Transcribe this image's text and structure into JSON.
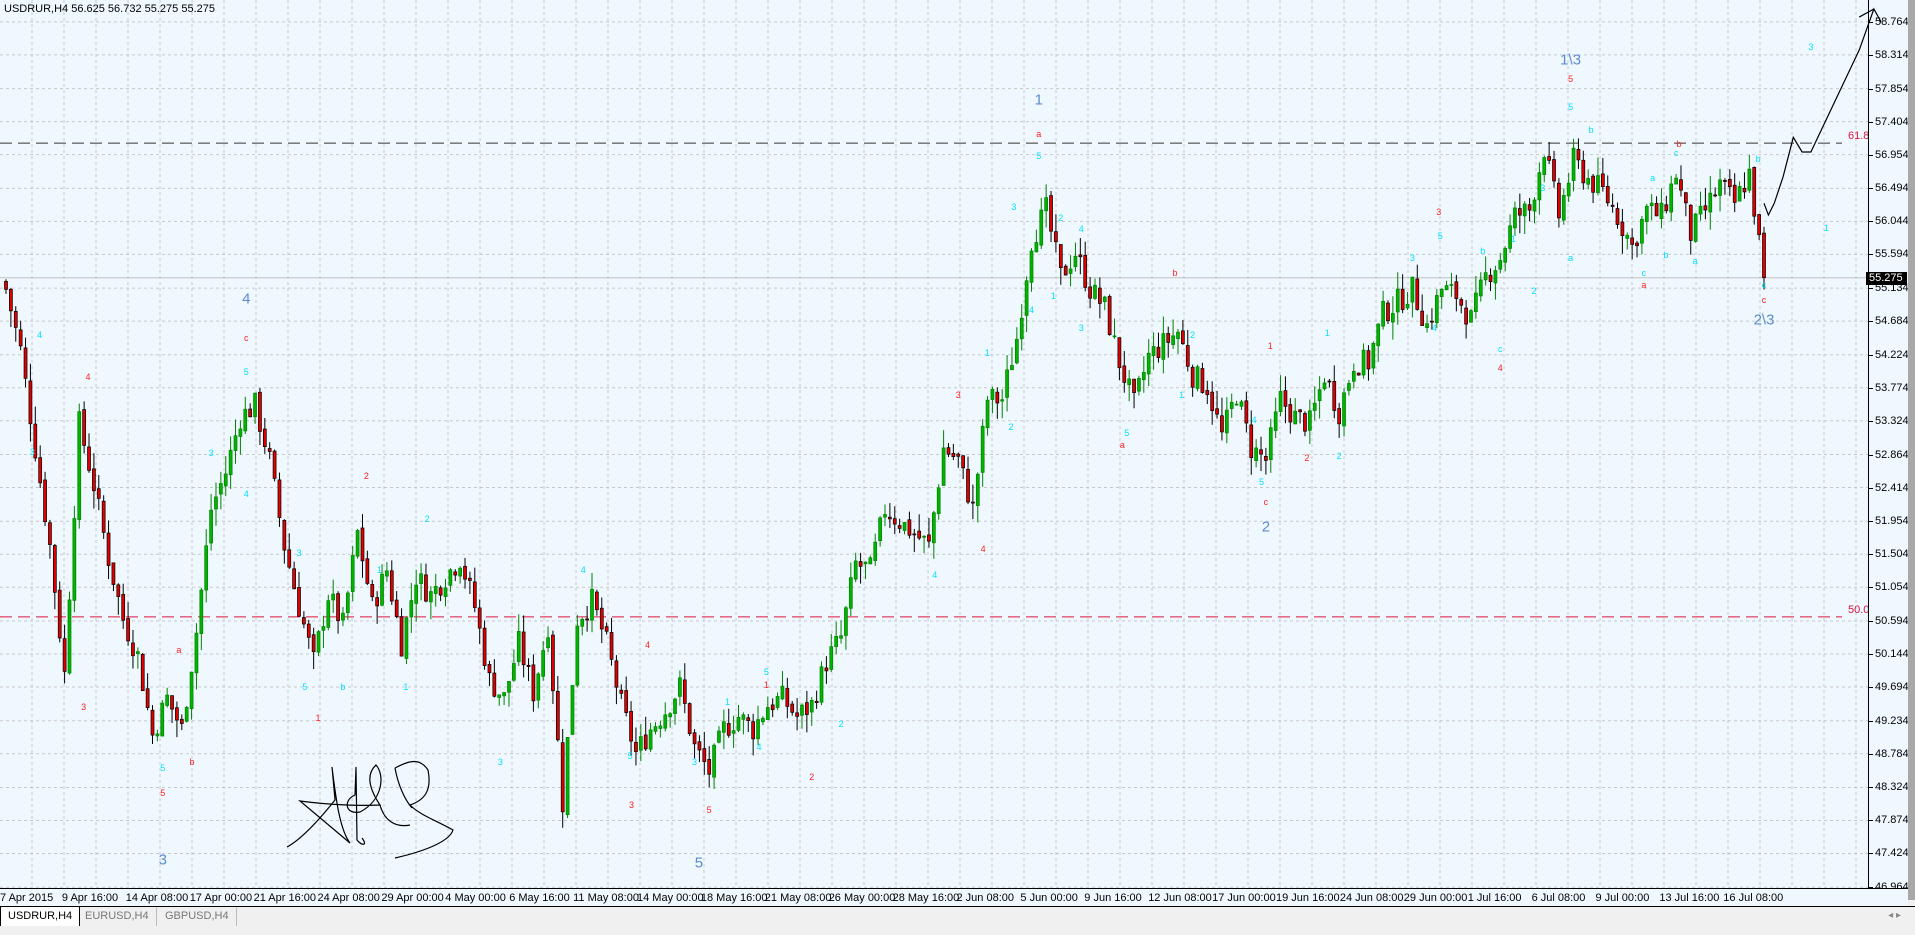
{
  "header": {
    "title": "USDRUR,H4  56.625 56.732 55.275 55.275"
  },
  "tabs": [
    {
      "label": "USDRUR,H4",
      "active": true
    },
    {
      "label": "EURUSD,H4",
      "active": false
    },
    {
      "label": "GBPUSD,H4",
      "active": false
    }
  ],
  "tab_scroll_label": "◂ ▸",
  "colors": {
    "background": "#f0f8ff",
    "bull": "#00b400",
    "bear": "#e00000",
    "level_line": "#dc143c",
    "wave_big": "#5b8bd0",
    "wave_red": "#ff2020",
    "wave_cyan": "#00e0ff"
  },
  "chart_data": {
    "type": "candlestick",
    "symbol": "USDRUR",
    "timeframe": "H4",
    "ohlc_header": {
      "open": 56.625,
      "high": 56.732,
      "low": 55.275,
      "close": 55.275
    },
    "current_price": 55.275,
    "current_price_label": "55.275",
    "ylim": [
      46.964,
      59.06
    ],
    "y_ticks": [
      "58.764",
      "58.314",
      "57.854",
      "57.404",
      "56.954",
      "56.494",
      "56.044",
      "55.594",
      "55.134",
      "54.684",
      "54.224",
      "53.774",
      "53.324",
      "52.864",
      "52.414",
      "51.954",
      "51.504",
      "51.054",
      "50.594",
      "50.144",
      "49.694",
      "49.234",
      "48.784",
      "48.324",
      "47.874",
      "47.424",
      "46.964"
    ],
    "x_ticks": [
      "7 Apr 2015",
      "9 Apr 16:00",
      "14 Apr 08:00",
      "17 Apr 00:00",
      "21 Apr 16:00",
      "24 Apr 08:00",
      "29 Apr 00:00",
      "4 May 00:00",
      "6 May 16:00",
      "11 May 08:00",
      "14 May 00:00",
      "18 May 16:00",
      "21 May 08:00",
      "26 May 00:00",
      "28 May 16:00",
      "2 Jun 08:00",
      "5 Jun 00:00",
      "9 Jun 16:00",
      "12 Jun 08:00",
      "17 Jun 00:00",
      "19 Jun 16:00",
      "24 Jun 08:00",
      "29 Jun 00:00",
      "1 Jul 16:00",
      "6 Jul 08:00",
      "9 Jul 00:00",
      "13 Jul 16:00",
      "16 Jul 08:00"
    ],
    "bars_per_point": 3,
    "closes": [
      55.12,
      54.29,
      52.95,
      51.62,
      49.87,
      53.29,
      52.45,
      51.45,
      50.62,
      50.12,
      49.04,
      49.54,
      49.12,
      50.45,
      52.12,
      52.62,
      53.37,
      53.54,
      52.79,
      51.62,
      50.79,
      50.04,
      50.95,
      50.54,
      51.79,
      50.79,
      51.29,
      50.29,
      51.2,
      50.95,
      51.2,
      51.45,
      50.79,
      49.79,
      49.54,
      50.29,
      49.62,
      50.54,
      48.12,
      50.62,
      50.87,
      50.29,
      49.45,
      48.79,
      49.12,
      49.37,
      49.7,
      48.87,
      48.54,
      49.12,
      49.29,
      49.12,
      49.45,
      49.54,
      49.29,
      49.45,
      50.04,
      50.37,
      51.37,
      51.29,
      52.12,
      51.95,
      51.79,
      51.62,
      52.95,
      52.79,
      52.12,
      53.62,
      53.62,
      54.45,
      55.79,
      56.2,
      55.29,
      55.62,
      55.12,
      54.87,
      54.12,
      53.54,
      54.2,
      54.37,
      54.54,
      53.95,
      53.79,
      53.12,
      53.7,
      52.95,
      52.79,
      53.62,
      53.37,
      53.29,
      53.95,
      53.45,
      54.12,
      54.12,
      54.79,
      54.95,
      55.12,
      54.62,
      55.12,
      55.04,
      54.7,
      55.29,
      55.54,
      56.12,
      56.2,
      57.04,
      56.12,
      56.87,
      56.62,
      56.45,
      56.12,
      55.7,
      56.2,
      56.12,
      56.7,
      55.87,
      56.2,
      56.54,
      56.29,
      56.7,
      55.275
    ],
    "levels": [
      {
        "label": "61.8",
        "price": 57.11,
        "style": "dashed-dark"
      },
      {
        "label": "50.0",
        "price": 50.65,
        "style": "dashed-red"
      }
    ],
    "forecast_path": [
      [
        120,
        56.29
      ],
      [
        120.3,
        56.13
      ],
      [
        120.7,
        56.29
      ],
      [
        121.3,
        56.65
      ],
      [
        122,
        57.19
      ],
      [
        122.6,
        56.99
      ],
      [
        123.2,
        56.99
      ],
      [
        126.5,
        58.38
      ],
      [
        127.5,
        58.94
      ],
      [
        128,
        58.76
      ]
    ],
    "forecast_branch": [
      [
        126.5,
        58.83
      ],
      [
        127.5,
        58.94
      ]
    ],
    "wave_labels": [
      {
        "t": "4",
        "k": 16.4,
        "p": 54.99,
        "c": "big"
      },
      {
        "t": "1",
        "k": 70.5,
        "p": 57.7,
        "c": "big"
      },
      {
        "t": "1\\3",
        "k": 106.8,
        "p": 58.25,
        "c": "big"
      },
      {
        "t": "2\\3",
        "k": 120,
        "p": 54.7,
        "c": "big"
      },
      {
        "t": "2",
        "k": 86,
        "p": 51.87,
        "c": "big"
      },
      {
        "t": "3",
        "k": 10.7,
        "p": 47.34,
        "c": "big"
      },
      {
        "t": "5",
        "k": 47.3,
        "p": 47.29,
        "c": "big"
      },
      {
        "t": "4",
        "k": 5.6,
        "p": 53.92,
        "c": "red"
      },
      {
        "t": "3",
        "k": 5.3,
        "p": 49.42,
        "c": "red"
      },
      {
        "t": "5",
        "k": 10.7,
        "p": 48.25,
        "c": "red"
      },
      {
        "t": "b",
        "k": 12.7,
        "p": 48.67,
        "c": "red"
      },
      {
        "t": "a",
        "k": 11.8,
        "p": 50.2,
        "c": "red"
      },
      {
        "t": "c",
        "k": 16.4,
        "p": 54.45,
        "c": "red"
      },
      {
        "t": "2",
        "k": 24.6,
        "p": 52.57,
        "c": "red"
      },
      {
        "t": "1",
        "k": 21.3,
        "p": 49.27,
        "c": "red"
      },
      {
        "t": "4",
        "k": 43.8,
        "p": 50.27,
        "c": "red"
      },
      {
        "t": "3",
        "k": 42.7,
        "p": 48.09,
        "c": "red"
      },
      {
        "t": "5",
        "k": 48,
        "p": 48.02,
        "c": "red"
      },
      {
        "t": "1",
        "k": 51.9,
        "p": 49.72,
        "c": "red"
      },
      {
        "t": "2",
        "k": 55,
        "p": 48.47,
        "c": "red"
      },
      {
        "t": "3",
        "k": 65,
        "p": 53.67,
        "c": "red"
      },
      {
        "t": "4",
        "k": 66.7,
        "p": 51.57,
        "c": "red"
      },
      {
        "t": "a",
        "k": 70.5,
        "p": 57.24,
        "c": "red"
      },
      {
        "t": "b",
        "k": 79.8,
        "p": 55.34,
        "c": "red"
      },
      {
        "t": "a",
        "k": 76.2,
        "p": 53.0,
        "c": "red"
      },
      {
        "t": "1",
        "k": 86.3,
        "p": 54.35,
        "c": "red"
      },
      {
        "t": "c",
        "k": 86,
        "p": 52.22,
        "c": "red"
      },
      {
        "t": "2",
        "k": 88.8,
        "p": 52.82,
        "c": "red"
      },
      {
        "t": "3",
        "k": 97.8,
        "p": 56.17,
        "c": "red"
      },
      {
        "t": "4",
        "k": 102,
        "p": 54.04,
        "c": "red"
      },
      {
        "t": "5",
        "k": 106.8,
        "p": 57.99,
        "c": "red"
      },
      {
        "t": "b",
        "k": 114.2,
        "p": 57.1,
        "c": "red"
      },
      {
        "t": "a",
        "k": 111.8,
        "p": 55.17,
        "c": "red"
      },
      {
        "t": "c",
        "k": 120,
        "p": 54.97,
        "c": "red"
      },
      {
        "t": "4",
        "k": 2.3,
        "p": 54.5,
        "c": "cyan"
      },
      {
        "t": "3",
        "k": 1.8,
        "p": 52.9,
        "c": "cyan"
      },
      {
        "t": "5",
        "k": 10.7,
        "p": 48.59,
        "c": "cyan"
      },
      {
        "t": "3",
        "k": 14,
        "p": 52.89,
        "c": "cyan"
      },
      {
        "t": "4",
        "k": 16.4,
        "p": 52.32,
        "c": "cyan"
      },
      {
        "t": "5",
        "k": 16.4,
        "p": 53.99,
        "c": "cyan"
      },
      {
        "t": "3",
        "k": 20,
        "p": 51.52,
        "c": "cyan"
      },
      {
        "t": "5",
        "k": 20.4,
        "p": 49.7,
        "c": "cyan"
      },
      {
        "t": "1",
        "k": 25.5,
        "p": 51.29,
        "c": "cyan"
      },
      {
        "t": "b",
        "k": 23,
        "p": 49.7,
        "c": "cyan"
      },
      {
        "t": "2",
        "k": 28.75,
        "p": 51.99,
        "c": "cyan"
      },
      {
        "t": "1",
        "k": 27.3,
        "p": 49.69,
        "c": "cyan"
      },
      {
        "t": "3",
        "k": 33.75,
        "p": 48.67,
        "c": "cyan"
      },
      {
        "t": "4",
        "k": 39.4,
        "p": 51.29,
        "c": "cyan"
      },
      {
        "t": "5",
        "k": 42.6,
        "p": 48.75,
        "c": "cyan"
      },
      {
        "t": "3",
        "k": 47,
        "p": 48.67,
        "c": "cyan"
      },
      {
        "t": "1",
        "k": 49.25,
        "p": 49.49,
        "c": "cyan"
      },
      {
        "t": "5",
        "k": 51.9,
        "p": 49.9,
        "c": "cyan"
      },
      {
        "t": "4",
        "k": 51.4,
        "p": 48.87,
        "c": "cyan"
      },
      {
        "t": "2",
        "k": 57,
        "p": 49.19,
        "c": "cyan"
      },
      {
        "t": "4",
        "k": 63.4,
        "p": 51.22,
        "c": "cyan"
      },
      {
        "t": "2",
        "k": 68.6,
        "p": 53.24,
        "c": "cyan"
      },
      {
        "t": "1",
        "k": 67,
        "p": 54.25,
        "c": "cyan"
      },
      {
        "t": "4",
        "k": 70,
        "p": 54.84,
        "c": "cyan"
      },
      {
        "t": "3",
        "k": 68.8,
        "p": 56.24,
        "c": "cyan"
      },
      {
        "t": "5",
        "k": 70.5,
        "p": 56.94,
        "c": "cyan"
      },
      {
        "t": "2",
        "k": 72,
        "p": 56.09,
        "c": "cyan"
      },
      {
        "t": "4",
        "k": 73.4,
        "p": 55.94,
        "c": "cyan"
      },
      {
        "t": "1",
        "k": 71.5,
        "p": 55.02,
        "c": "cyan"
      },
      {
        "t": "3",
        "k": 73.4,
        "p": 54.59,
        "c": "cyan"
      },
      {
        "t": "5",
        "k": 76.5,
        "p": 53.16,
        "c": "cyan"
      },
      {
        "t": "1",
        "k": 80.25,
        "p": 53.67,
        "c": "cyan"
      },
      {
        "t": "2",
        "k": 81,
        "p": 54.5,
        "c": "cyan"
      },
      {
        "t": "4",
        "k": 85.2,
        "p": 53.34,
        "c": "cyan"
      },
      {
        "t": "5",
        "k": 85.7,
        "p": 52.49,
        "c": "cyan"
      },
      {
        "t": "2",
        "k": 91,
        "p": 52.85,
        "c": "cyan"
      },
      {
        "t": "1",
        "k": 90.2,
        "p": 54.52,
        "c": "cyan"
      },
      {
        "t": "3",
        "k": 96,
        "p": 55.54,
        "c": "cyan"
      },
      {
        "t": "5",
        "k": 97.9,
        "p": 55.84,
        "c": "cyan"
      },
      {
        "t": "4",
        "k": 97.5,
        "p": 54.59,
        "c": "cyan"
      },
      {
        "t": "b",
        "k": 100.8,
        "p": 55.64,
        "c": "cyan"
      },
      {
        "t": "1",
        "k": 102.9,
        "p": 55.8,
        "c": "cyan"
      },
      {
        "t": "c",
        "k": 102,
        "p": 54.3,
        "c": "cyan"
      },
      {
        "t": "2",
        "k": 104.3,
        "p": 55.09,
        "c": "cyan"
      },
      {
        "t": "3",
        "k": 104.9,
        "p": 56.5,
        "c": "cyan"
      },
      {
        "t": "5",
        "k": 106.8,
        "p": 57.6,
        "c": "cyan"
      },
      {
        "t": "b",
        "k": 108.2,
        "p": 57.29,
        "c": "cyan"
      },
      {
        "t": "a",
        "k": 106.8,
        "p": 55.55,
        "c": "cyan"
      },
      {
        "t": "a",
        "k": 112.4,
        "p": 56.64,
        "c": "cyan"
      },
      {
        "t": "c",
        "k": 114,
        "p": 56.97,
        "c": "cyan"
      },
      {
        "t": "b",
        "k": 113.3,
        "p": 55.59,
        "c": "cyan"
      },
      {
        "t": "c",
        "k": 111.8,
        "p": 55.34,
        "c": "cyan"
      },
      {
        "t": "a",
        "k": 115.3,
        "p": 55.5,
        "c": "cyan"
      },
      {
        "t": "b",
        "k": 119.6,
        "p": 56.9,
        "c": "cyan"
      },
      {
        "t": "c",
        "k": 120,
        "p": 55.17,
        "c": "cyan"
      },
      {
        "t": "3",
        "k": 123.2,
        "p": 58.42,
        "c": "cyan"
      },
      {
        "t": "1",
        "k": 124.25,
        "p": 55.95,
        "c": "cyan"
      }
    ]
  }
}
